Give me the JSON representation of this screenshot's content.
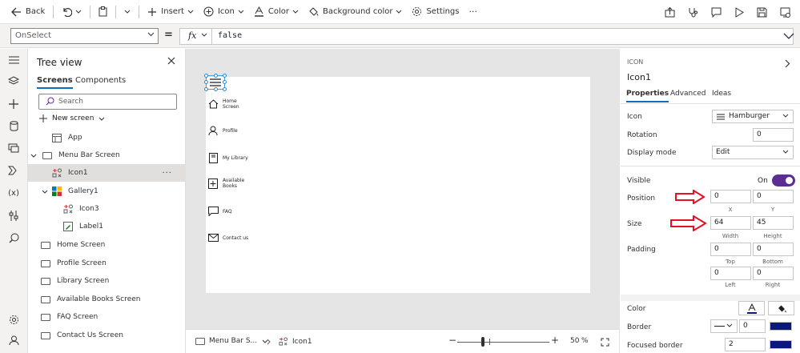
{
  "commandbar": {
    "back": "Back",
    "insert": "Insert",
    "icon": "Icon",
    "color": "Color",
    "background_color": "Background color",
    "settings": "Settings",
    "more": "···"
  },
  "formula_bar": {
    "property": "OnSelect",
    "equals": "=",
    "fx": "fx",
    "formula": "false"
  },
  "tree": {
    "title": "Tree view",
    "tabs": [
      "Screens",
      "Components"
    ],
    "search_placeholder": "Search",
    "new_screen": "New screen",
    "items": [
      {
        "label": "App",
        "indent": 0
      },
      {
        "label": "Menu Bar Screen",
        "indent": 0
      },
      {
        "label": "Icon1",
        "indent": 1
      },
      {
        "label": "Gallery1",
        "indent": 1
      },
      {
        "label": "Icon3",
        "indent": 2
      },
      {
        "label": "Label1",
        "indent": 2
      },
      {
        "label": "Home Screen",
        "indent": 0
      },
      {
        "label": "Profile Screen",
        "indent": 0
      },
      {
        "label": "Library Screen",
        "indent": 0
      },
      {
        "label": "Available Books Screen",
        "indent": 0
      },
      {
        "label": "FAQ Screen",
        "indent": 0
      },
      {
        "label": "Contact Us Screen",
        "indent": 0
      }
    ],
    "more": "···"
  },
  "canvas": {
    "menu": [
      {
        "label": "Home Screen",
        "icon": "home-icon"
      },
      {
        "label": "Profile",
        "icon": "person-icon"
      },
      {
        "label": "My Library",
        "icon": "book-icon"
      },
      {
        "label": "Available Books",
        "icon": "add-icon"
      },
      {
        "label": "FAQ",
        "icon": "chat-icon"
      },
      {
        "label": "Contact us",
        "icon": "mail-icon"
      }
    ]
  },
  "status": {
    "screen": "Menu Bar S...",
    "control": "Icon1",
    "zoom_value": "50",
    "zoom_unit": "%",
    "zoom_level": 50
  },
  "properties": {
    "kind": "ICON",
    "name": "Icon1",
    "tabs": [
      "Properties",
      "Advanced",
      "Ideas"
    ],
    "icon_label": "Icon",
    "icon_value": "Hamburger",
    "rotation_label": "Rotation",
    "rotation_value": "0",
    "display_mode_label": "Display mode",
    "display_mode_value": "Edit",
    "visible_label": "Visible",
    "visible_state": "On",
    "position_label": "Position",
    "position_x": "0",
    "position_y": "0",
    "x_label": "X",
    "y_label": "Y",
    "size_label": "Size",
    "width_value": "64",
    "height_value": "45",
    "width_label": "Width",
    "height_label": "Height",
    "padding_label": "Padding",
    "padding_top": "0",
    "padding_bottom": "0",
    "padding_left": "0",
    "padding_right": "0",
    "top_label": "Top",
    "bottom_label": "Bottom",
    "left_label": "Left",
    "right_label": "Right",
    "color_label": "Color",
    "border_label": "Border",
    "border_value": "0",
    "focused_border_label": "Focused border",
    "focused_border_value": "2",
    "icon_color": "#0b1a7a",
    "toggle_color": "#5b2e91"
  }
}
